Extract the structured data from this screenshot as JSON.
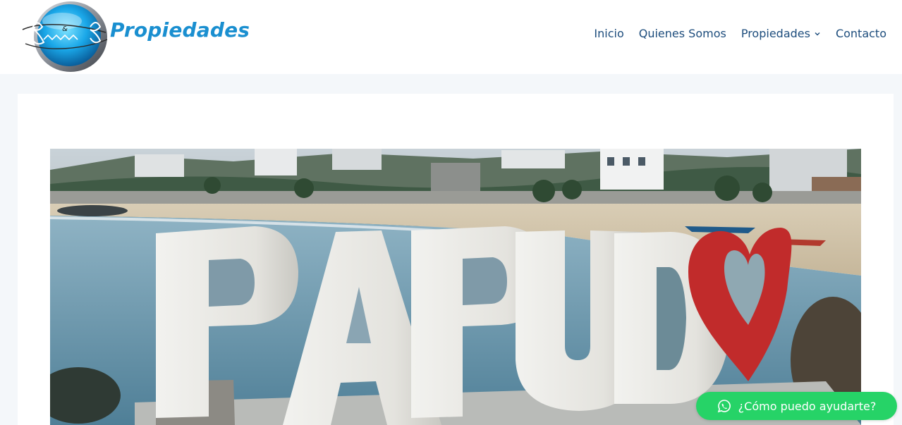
{
  "header": {
    "logo_text": "Propiedades",
    "logo_mark_text": "B&B"
  },
  "nav": {
    "items": [
      {
        "label": "Inicio"
      },
      {
        "label": "Quienes Somos"
      },
      {
        "label": "Propiedades",
        "has_dropdown": true,
        "icon": "chevron-down-icon"
      },
      {
        "label": "Contacto"
      }
    ]
  },
  "hero": {
    "sign_text": "PAPUD",
    "sign_heart_icon": "heart-icon"
  },
  "whatsapp": {
    "label": "¿Cómo puedo ayudarte?",
    "icon": "whatsapp-icon"
  },
  "colors": {
    "brand_blue": "#1a8fd0",
    "nav_text": "#1c4c7c",
    "whatsapp_green": "#26d367",
    "page_bg": "#f4f7fa"
  }
}
